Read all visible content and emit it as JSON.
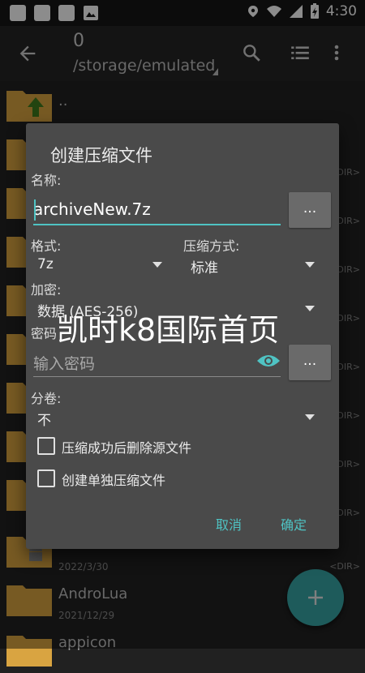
{
  "statusbar": {
    "time": "4:30"
  },
  "appbar": {
    "count": "0",
    "path": "/storage/emulated"
  },
  "file_list": {
    "up_label": "..",
    "dir_tag": "<DIR>",
    "rows": [
      {
        "name": "",
        "date": "2022/3/30"
      },
      {
        "name": "AndroLua",
        "date": "2021/12/29"
      },
      {
        "name": "appicon",
        "date": ""
      }
    ]
  },
  "dialog": {
    "title": "创建压缩文件",
    "name_label": "名称:",
    "name_value": "archiveNew.7z",
    "browse_label": "...",
    "format_label": "格式:",
    "format_value": "7z",
    "method_label": "压缩方式:",
    "method_value": "标准",
    "encrypt_label": "加密:",
    "encrypt_value": "数据 (AES-256)",
    "password_label": "密码",
    "password_placeholder": "输入密码",
    "password_browse": "...",
    "split_label": "分卷:",
    "split_value": "不",
    "checkbox_delete": "压缩成功后删除源文件",
    "checkbox_single": "创建单独压缩文件",
    "cancel": "取消",
    "ok": "确定"
  },
  "watermark": "凯时k8国际首页",
  "colors": {
    "accent": "#4fc3c3",
    "folder": "#d9a441",
    "fab": "#37a6a6",
    "dialog": "#4a4a4a"
  }
}
